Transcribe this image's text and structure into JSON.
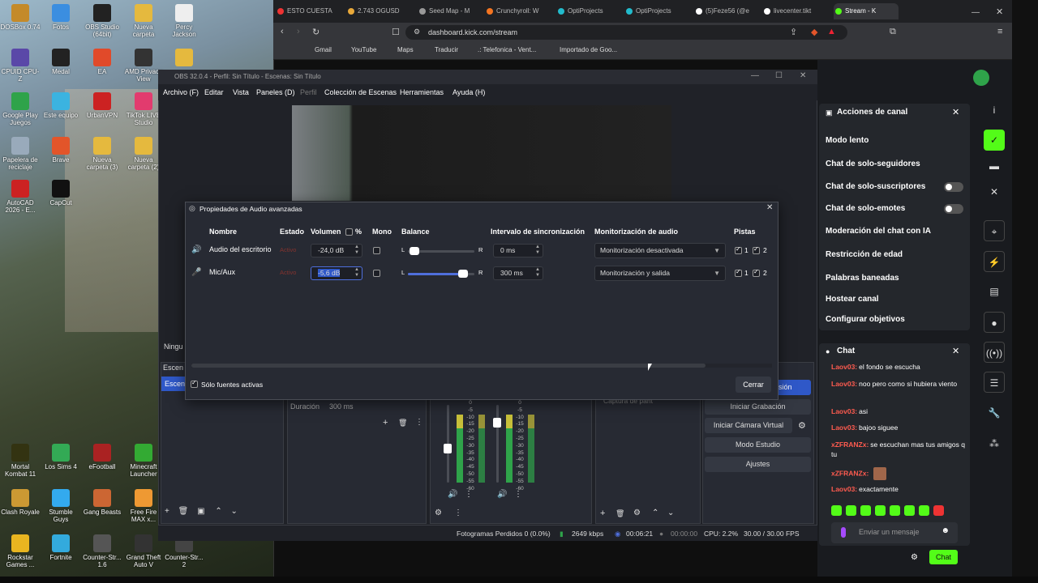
{
  "desktop": {
    "icons": [
      {
        "label": "DOSBox 0.74",
        "col": 0,
        "row": 0,
        "color": "#c48a2a"
      },
      {
        "label": "Fotos",
        "col": 1,
        "row": 0,
        "color": "#3b8ee0"
      },
      {
        "label": "OBS Studio (64bit)",
        "col": 2,
        "row": 0,
        "color": "#222"
      },
      {
        "label": "Nueva carpeta",
        "col": 3,
        "row": 0,
        "color": "#e5b93e"
      },
      {
        "label": "Percy Jackson",
        "col": 4,
        "row": 0,
        "color": "#eee"
      },
      {
        "label": "CPUID CPU-Z",
        "col": 0,
        "row": 1,
        "color": "#5a48a8"
      },
      {
        "label": "Medal",
        "col": 1,
        "row": 1,
        "color": "#222"
      },
      {
        "label": "EA",
        "col": 2,
        "row": 1,
        "color": "#e14a2a"
      },
      {
        "label": "AMD Privacy View",
        "col": 3,
        "row": 1,
        "color": "#333"
      },
      {
        "label": "",
        "col": 4,
        "row": 1,
        "color": "#e5b93e"
      },
      {
        "label": "Google Play Juegos",
        "col": 0,
        "row": 2,
        "color": "#2fa34a"
      },
      {
        "label": "Este equipo",
        "col": 1,
        "row": 2,
        "color": "#3bb3e0"
      },
      {
        "label": "UrbanVPN",
        "col": 2,
        "row": 2,
        "color": "#c22"
      },
      {
        "label": "TikTok LIVE Studio",
        "col": 3,
        "row": 2,
        "color": "#e23b6e"
      },
      {
        "label": "Papelera de reciclaje",
        "col": 0,
        "row": 3,
        "color": "#9ab"
      },
      {
        "label": "Brave",
        "col": 1,
        "row": 3,
        "color": "#e2552a"
      },
      {
        "label": "Nueva carpeta (3)",
        "col": 2,
        "row": 3,
        "color": "#e5b93e"
      },
      {
        "label": "Nueva carpeta (2)",
        "col": 3,
        "row": 3,
        "color": "#e5b93e"
      },
      {
        "label": "AutoCAD 2026 - E...",
        "col": 0,
        "row": 4,
        "color": "#c22"
      },
      {
        "label": "CapCut",
        "col": 1,
        "row": 4,
        "color": "#111"
      },
      {
        "label": "Mortal Kombat 11",
        "col": 0,
        "row": 5,
        "color": "#331"
      },
      {
        "label": "Los Sims 4",
        "col": 1,
        "row": 5,
        "color": "#3a5"
      },
      {
        "label": "eFootball",
        "col": 2,
        "row": 5,
        "color": "#a22"
      },
      {
        "label": "Minecraft Launcher",
        "col": 3,
        "row": 5,
        "color": "#3a3"
      },
      {
        "label": "Clash Royale",
        "col": 0,
        "row": 6,
        "color": "#c93"
      },
      {
        "label": "Stumble Guys",
        "col": 1,
        "row": 6,
        "color": "#3ae"
      },
      {
        "label": "Gang Beasts",
        "col": 2,
        "row": 6,
        "color": "#c63"
      },
      {
        "label": "Free Fire MAX x...",
        "col": 3,
        "row": 6,
        "color": "#e93"
      },
      {
        "label": "Rockstar Games ...",
        "col": 0,
        "row": 7,
        "color": "#e9b520"
      },
      {
        "label": "Fortnite",
        "col": 1,
        "row": 7,
        "color": "#3ad"
      },
      {
        "label": "Counter-Str... 1.6",
        "col": 2,
        "row": 7,
        "color": "#555"
      },
      {
        "label": "Grand Theft Auto V",
        "col": 3,
        "row": 7,
        "color": "#333"
      },
      {
        "label": "Counter-Str... 2",
        "col": 4,
        "row": 7,
        "color": "#444"
      }
    ]
  },
  "browser": {
    "tabs": [
      {
        "label": "ESTO CUESTA",
        "color": "#e33"
      },
      {
        "label": "2.743 OGUSD",
        "color": "#e9a93a"
      },
      {
        "label": "Seed Map - M",
        "color": "#999"
      },
      {
        "label": "Crunchyroll: W",
        "color": "#f47521"
      },
      {
        "label": "OptiProjects",
        "color": "#2bc"
      },
      {
        "label": "OptiProjects",
        "color": "#2bc"
      },
      {
        "label": "(5)Feze56 (@e",
        "color": "#fff"
      },
      {
        "label": "livecenter.tikt",
        "color": "#fff"
      },
      {
        "label": "Stream - K",
        "color": "#53fc18"
      }
    ],
    "url": "dashboard.kick.com/stream",
    "bookmarks": [
      "Gmail",
      "YouTube",
      "Maps",
      "Traducir",
      ".: Telefonica - Vent...",
      "Importado de Goo..."
    ]
  },
  "obs": {
    "title": "OBS 32.0.4 - Perfil: Sin Título - Escenas: Sin Título",
    "menu": [
      "Archivo (F)",
      "Editar",
      "Vista",
      "Paneles (D)",
      "Perfil",
      "Colección de Escenas",
      "Herramientas",
      "Ayuda (H)"
    ],
    "duration_label": "Duración",
    "duration_value": "300 ms",
    "ninguna": "Ningu",
    "escenas": "Escen",
    "source_capture": "Captura de pant",
    "controls": {
      "start_recording": "Iniciar Grabación",
      "virtual_cam": "Iniciar Cámara Virtual",
      "studio_mode": "Modo Estudio",
      "settings": "Ajustes",
      "stream_partial": "sión"
    },
    "meter_ticks": [
      "0",
      "-5",
      "-10",
      "-15",
      "-20",
      "-25",
      "-30",
      "-35",
      "-40",
      "-45",
      "-50",
      "-55",
      "-60"
    ],
    "status": {
      "dropped": "Fotogramas Perdidos 0 (0.0%)",
      "bitrate": "2649 kbps",
      "live_time": "00:06:21",
      "rec_time": "00:00:00",
      "cpu": "CPU: 2.2%",
      "fps": "30.00 / 30.00 FPS"
    }
  },
  "dialog": {
    "title": "Propiedades de Audio avanzadas",
    "headers": {
      "name": "Nombre",
      "state": "Estado",
      "volume": "Volumen",
      "percent": "%",
      "mono": "Mono",
      "balance": "Balance",
      "sync": "Intervalo de sincronización",
      "monitoring": "Monitorización de audio",
      "tracks": "Pistas"
    },
    "rows": [
      {
        "name": "Audio del escritorio",
        "state": "Activo",
        "volume": "-24,0 dB",
        "balance_L": "L",
        "balance_R": "R",
        "balance": 0.1,
        "sync": "0 ms",
        "monitoring": "Monitorización desactivada",
        "track1": "1",
        "track2": "2"
      },
      {
        "name": "Mic/Aux",
        "state": "Activo",
        "volume": "-5,6 dB",
        "balance_L": "L",
        "balance_R": "R",
        "balance": 0.83,
        "sync": "300 ms",
        "monitoring": "Monitorización y salida",
        "track1": "1",
        "track2": "2"
      }
    ],
    "active_only": "Sólo fuentes activas",
    "close": "Cerrar"
  },
  "kick": {
    "actions_title": "Acciones de canal",
    "actions": [
      {
        "label": "Modo lento",
        "type": "chevron"
      },
      {
        "label": "Chat de solo-seguidores",
        "type": "chevron"
      },
      {
        "label": "Chat de solo-suscriptores",
        "type": "toggle"
      },
      {
        "label": "Chat de solo-emotes",
        "type": "toggle"
      },
      {
        "label": "Moderación del chat con IA",
        "type": "external"
      },
      {
        "label": "Restricción de edad",
        "type": "chevron"
      },
      {
        "label": "Palabras baneadas",
        "type": "chevron"
      },
      {
        "label": "Hostear canal",
        "type": "none"
      },
      {
        "label": "Configurar objetivos",
        "type": "chevron"
      }
    ],
    "chat_title": "Chat",
    "messages": [
      {
        "user": "Laov03:",
        "text": "el fondo se escucha"
      },
      {
        "user": "Laov03:",
        "text": "noo pero como si hubiera viento"
      },
      {
        "user": "Laov03:",
        "text": "asi"
      },
      {
        "user": "Laov03:",
        "text": "bajoo siguee"
      },
      {
        "user": "xZFRANZx:",
        "text": "se escuchan mas tus amigos q tu"
      },
      {
        "user": "xZFRANZx:",
        "text": ""
      },
      {
        "user": "Laov03:",
        "text": "exactamente"
      }
    ],
    "chat_placeholder": "Enviar un mensaje",
    "chat_button": "Chat",
    "accent": "#53fc18"
  }
}
